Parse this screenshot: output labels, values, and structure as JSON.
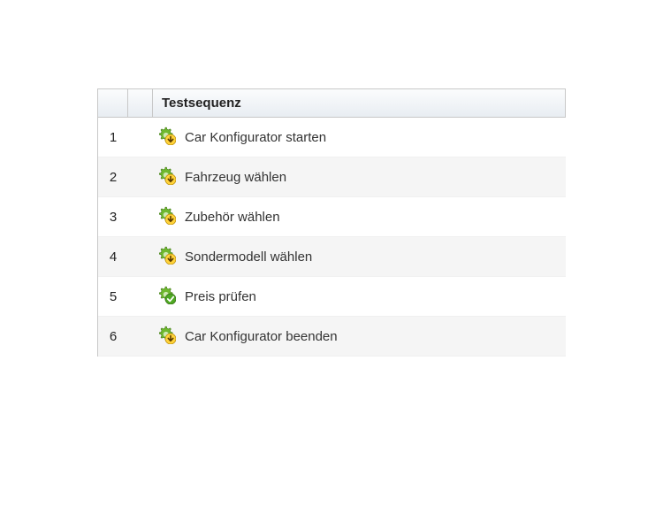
{
  "table": {
    "header": {
      "col1": "",
      "col2": "",
      "col3": "Testsequenz"
    },
    "rows": [
      {
        "num": "1",
        "icon": "gear-arrow",
        "label": "Car Konfigurator starten"
      },
      {
        "num": "2",
        "icon": "gear-arrow",
        "label": "Fahrzeug wählen"
      },
      {
        "num": "3",
        "icon": "gear-arrow",
        "label": "Zubehör wählen"
      },
      {
        "num": "4",
        "icon": "gear-arrow",
        "label": "Sondermodell wählen"
      },
      {
        "num": "5",
        "icon": "gear-check",
        "label": "Preis prüfen"
      },
      {
        "num": "6",
        "icon": "gear-arrow",
        "label": "Car Konfigurator beenden"
      }
    ]
  }
}
